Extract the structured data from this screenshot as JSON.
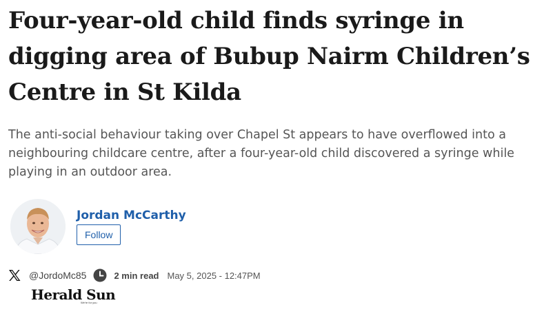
{
  "article": {
    "headline": "Four-year-old child finds syringe in digging area of Bubup Nairm Children’s Centre in St Kilda",
    "standfirst": "The anti-social behaviour taking over Chapel St appears to have overflowed into a neighbouring childcare centre, after a four-year-old child discovered a syringe while playing in an outdoor area."
  },
  "author": {
    "name": "Jordan McCarthy",
    "follow_label": "Follow",
    "x_handle": "@JordoMc85"
  },
  "meta": {
    "read_time": "2 min read",
    "published": "May 5, 2025 - 12:47PM"
  },
  "publication": {
    "name": "Herald Sun",
    "tagline": "We're for you"
  },
  "colors": {
    "link_blue": "#1f5faa",
    "headline": "#1a1a1a",
    "standfirst": "#555555"
  },
  "icons": {
    "social": "x-logo-icon",
    "time": "clock-icon"
  }
}
